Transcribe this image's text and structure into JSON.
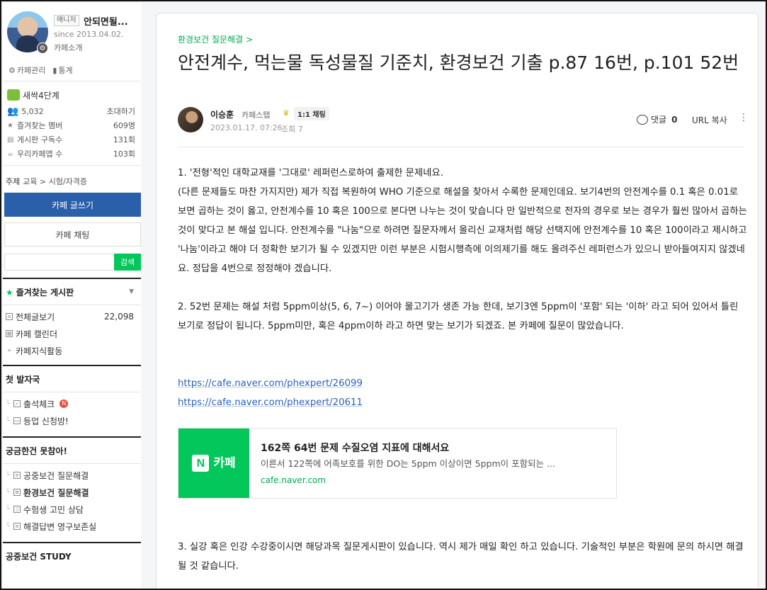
{
  "sidebar": {
    "manager_badge": "매니저",
    "cafe_name": "안되면될...",
    "since": "since 2013.04.02.",
    "cafe_intro": "카페소개",
    "cafe_admin": "카페관리",
    "stats_link": "통계",
    "level": "새싹4단계",
    "member_count": "5,032",
    "invite": "초대하기",
    "fav_member_label": "즐겨찾는 멤버",
    "fav_member_value": "609명",
    "board_sub_label": "게시판 구독수",
    "board_sub_value": "131회",
    "app_label": "우리카페앱 수",
    "app_value": "103회",
    "topic_label": "주제",
    "topic_value": "교육 > 시험/자격증",
    "write_button": "카페 글쓰기",
    "chat_button": "카페 채팅",
    "search_placeholder": "",
    "search_button": "검색",
    "favorites_title": "즐겨찾는 게시판",
    "all_posts": "전체글보기",
    "all_posts_count": "22,098",
    "calendar": "카페 캘린더",
    "knowledge": "카페지식활동",
    "section1_title": "첫 발자국",
    "attendance": "출석체크",
    "new_badge": "N",
    "levelup": "등업 신청방!",
    "section2_title": "궁금한건 못참아!",
    "public_health_qa": "공중보건 질문해결",
    "env_health_qa": "환경보건 질문해결",
    "student_counsel": "수험생 고민 상담",
    "answer_archive": "해결답변 영구보존실",
    "section3_title": "공중보건 STUDY"
  },
  "post": {
    "breadcrumb": "환경보건 질문해결 >",
    "title": "안전계수, 먹는물 독성물질 기준치, 환경보건 기출 p.87 16번, p.101 52번",
    "author": "이승훈",
    "grade": "카페스탭",
    "chat": "1:1 채팅",
    "date": "2023.01.17. 07:26",
    "views": "조회 7",
    "comment_label": "댓글",
    "comment_count": "0",
    "url_copy": "URL 복사",
    "p1_line1": "1. '전형'적인 대학교재를 '그대로' 레퍼런스로하여 출제한 문제네요.",
    "p1_line2": "(다른 문제들도 마찬 가지지만) 제가 직접 복원하여 WHO 기준으로 해설을 찾아서 수록한 문제인데요. 보기4번의 안전계수를 0.1 혹은 0.01로 보면 곱하는 것이 옳고, 안전계수를 10 혹은 100으로 본다면 나누는 것이 맞습니다 만 일반적으로 전자의 경우로 보는 경우가 훨씬 많아서 곱하는 것이 맞다고 본 해설 입니다.  안전계수를 \"나눔\"으로 하려면 질문자께서 올리신 교재처럼 해당 선택지에 안전계수를 10 혹은 100이라고 제시하고 '나눔'이라고 해야 더 정확한 보기가 될 수 있겠지만 이런 부분은 시험시행측에 이의제기를 해도 올려주신 레퍼런스가 있으니 받아들여지지 않겠네요. 정답을 4번으로 정정해야 겠습니다.",
    "p2": "2. 52번 문제는 해설 처럼 5ppm이상(5, 6, 7~) 이어야 물고기가 생존 가능 한데, 보기3엔 5ppm이 '포함' 되는 '이하' 라고 되어 있어서 틀린 보기로 정답이 됩니다. 5ppm미만, 혹은 4ppm이하 라고 하면 맞는 보기가 되겠죠.  본 카페에 질문이 많았습니다.",
    "link1": "https://cafe.naver.com/phexpert/26099",
    "link2": "https://cafe.naver.com/phexpert/20611",
    "card_logo": "N",
    "card_label": "카페",
    "card_title": "162쪽 64번 문제 수질오염 지표에 대해서요",
    "card_desc": "이른서 122쪽에 어족보호를 위한 DO는 5ppm 이상이면 5ppm이 포함되는 ...",
    "card_url": "cafe.naver.com",
    "p3": "3. 실강 혹은 인강 수강중이시면 해당과목 질문게시판이 있습니다. 역시 제가 매일 확인 하고 있습니다. 기술적인 부분은 학원에 문의 하시면 해결될 것 같습니다."
  },
  "colors": {
    "accent_green": "#03c75a",
    "write_blue": "#2a5fa9",
    "link_blue": "#2f62b6"
  }
}
